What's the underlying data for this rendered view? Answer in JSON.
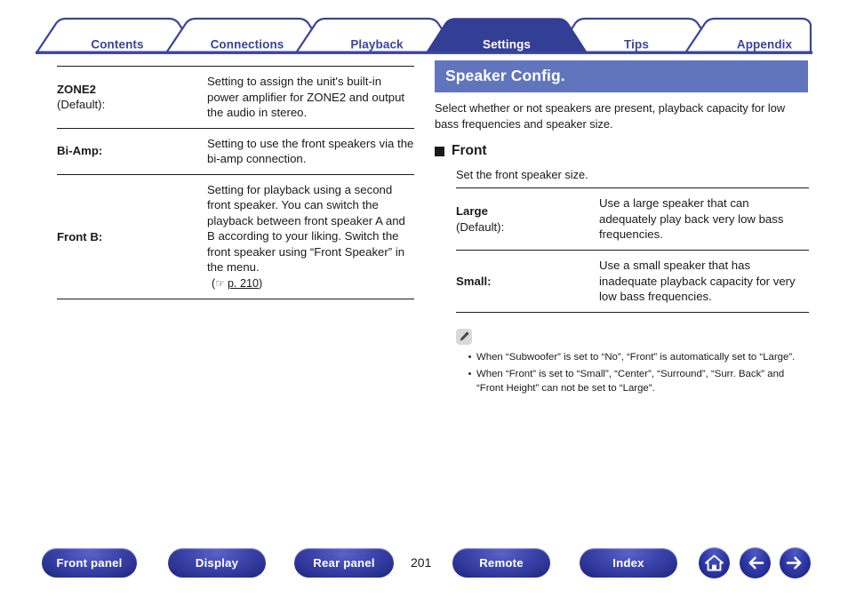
{
  "tabs": [
    {
      "label": "Contents",
      "active": false
    },
    {
      "label": "Connections",
      "active": false
    },
    {
      "label": "Playback",
      "active": false
    },
    {
      "label": "Settings",
      "active": true
    },
    {
      "label": "Tips",
      "active": false
    },
    {
      "label": "Appendix",
      "active": false
    }
  ],
  "left_table": {
    "rows": [
      {
        "term": "ZONE2",
        "term_sub": "(Default):",
        "desc": "Setting to assign the unit's built-in power amplifier for ZONE2 and output the audio in stereo.",
        "ref": null
      },
      {
        "term": "Bi-Amp:",
        "term_sub": "",
        "desc": "Setting to use the front speakers via the bi-amp connection.",
        "ref": null
      },
      {
        "term": "Front B:",
        "term_sub": "",
        "desc": "Setting for playback using a second front speaker. You can switch the playback between front speaker A and B according to your liking. Switch the front speaker using “Front Speaker” in the menu.",
        "ref": {
          "open": "(",
          "hand": "☞",
          "link": "p. 210",
          "close": ")"
        }
      }
    ]
  },
  "section": {
    "banner_title": "Speaker Config.",
    "intro": "Select whether or not speakers are present, playback capacity for low bass frequencies and speaker size.",
    "sub_heading": "Front",
    "sub_intro": "Set the front speaker size.",
    "table_rows": [
      {
        "term": "Large",
        "term_sub": "(Default):",
        "desc": "Use a large speaker that can adequately play back very low bass frequencies."
      },
      {
        "term": "Small:",
        "term_sub": "",
        "desc": "Use a small speaker that has inadequate playback capacity for very low bass frequencies."
      }
    ],
    "notes": [
      "When “Subwoofer” is set to “No”, “Front” is automatically set to “Large”.",
      "When “Front” is set to “Small”, “Center”, “Surround”, “Surr. Back” and “Front Height” can not be set to “Large”."
    ]
  },
  "footer": {
    "buttons": [
      {
        "label": "Front panel"
      },
      {
        "label": "Display"
      },
      {
        "label": "Rear panel"
      },
      {
        "label": "Remote"
      },
      {
        "label": "Index"
      }
    ],
    "page_number": "201",
    "icons": [
      {
        "name": "home-icon"
      },
      {
        "name": "arrow-left-icon"
      },
      {
        "name": "arrow-right-icon"
      }
    ]
  },
  "colors": {
    "tab_active_bg": "#333f94",
    "tab_text": "#3a44a0",
    "banner_bg": "#6175bd",
    "rule": "#1c1c1c"
  }
}
